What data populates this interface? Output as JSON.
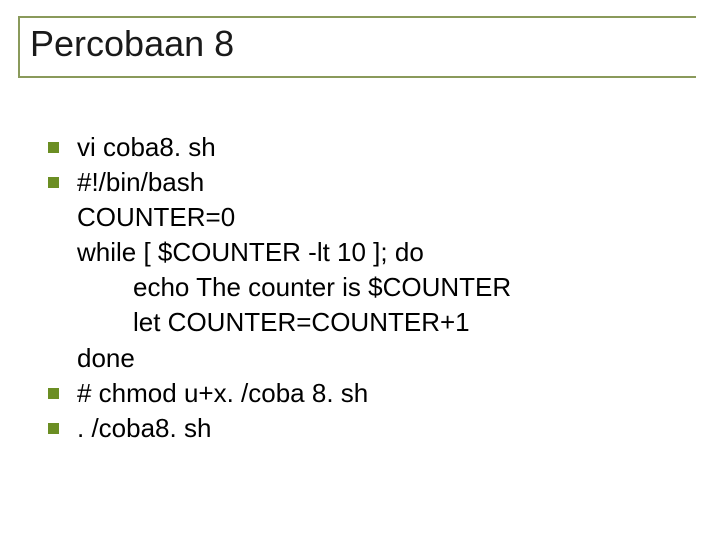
{
  "title": "Percobaan 8",
  "lines": [
    {
      "bullet": true,
      "indent": 0,
      "text": "vi coba8. sh"
    },
    {
      "bullet": true,
      "indent": 0,
      "text": "#!/bin/bash"
    },
    {
      "bullet": false,
      "indent": 0,
      "text": "COUNTER=0"
    },
    {
      "bullet": false,
      "indent": 0,
      "text": "while [ $COUNTER -lt 10 ]; do"
    },
    {
      "bullet": false,
      "indent": 1,
      "text": "echo The counter is $COUNTER"
    },
    {
      "bullet": false,
      "indent": 1,
      "text": "let COUNTER=COUNTER+1"
    },
    {
      "bullet": false,
      "indent": 0,
      "text": "done"
    },
    {
      "bullet": true,
      "indent": 0,
      "text": "# chmod u+x. /coba 8. sh"
    },
    {
      "bullet": true,
      "indent": 0,
      "text": ". /coba8. sh"
    }
  ],
  "colors": {
    "accent": "#6b8e23",
    "rule": "#8a9a5b",
    "text": "#000000",
    "bg": "#ffffff"
  }
}
